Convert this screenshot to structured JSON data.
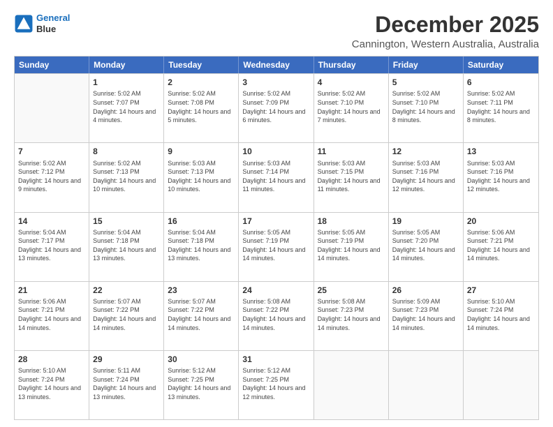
{
  "header": {
    "logo_line1": "General",
    "logo_line2": "Blue",
    "title": "December 2025",
    "subtitle": "Cannington, Western Australia, Australia"
  },
  "calendar": {
    "days_of_week": [
      "Sunday",
      "Monday",
      "Tuesday",
      "Wednesday",
      "Thursday",
      "Friday",
      "Saturday"
    ],
    "weeks": [
      [
        {
          "day": "",
          "empty": true
        },
        {
          "day": "1",
          "sunrise": "5:02 AM",
          "sunset": "7:07 PM",
          "daylight": "14 hours and 4 minutes."
        },
        {
          "day": "2",
          "sunrise": "5:02 AM",
          "sunset": "7:08 PM",
          "daylight": "14 hours and 5 minutes."
        },
        {
          "day": "3",
          "sunrise": "5:02 AM",
          "sunset": "7:09 PM",
          "daylight": "14 hours and 6 minutes."
        },
        {
          "day": "4",
          "sunrise": "5:02 AM",
          "sunset": "7:10 PM",
          "daylight": "14 hours and 7 minutes."
        },
        {
          "day": "5",
          "sunrise": "5:02 AM",
          "sunset": "7:10 PM",
          "daylight": "14 hours and 8 minutes."
        },
        {
          "day": "6",
          "sunrise": "5:02 AM",
          "sunset": "7:11 PM",
          "daylight": "14 hours and 8 minutes."
        }
      ],
      [
        {
          "day": "7",
          "sunrise": "5:02 AM",
          "sunset": "7:12 PM",
          "daylight": "14 hours and 9 minutes."
        },
        {
          "day": "8",
          "sunrise": "5:02 AM",
          "sunset": "7:13 PM",
          "daylight": "14 hours and 10 minutes."
        },
        {
          "day": "9",
          "sunrise": "5:03 AM",
          "sunset": "7:13 PM",
          "daylight": "14 hours and 10 minutes."
        },
        {
          "day": "10",
          "sunrise": "5:03 AM",
          "sunset": "7:14 PM",
          "daylight": "14 hours and 11 minutes."
        },
        {
          "day": "11",
          "sunrise": "5:03 AM",
          "sunset": "7:15 PM",
          "daylight": "14 hours and 11 minutes."
        },
        {
          "day": "12",
          "sunrise": "5:03 AM",
          "sunset": "7:16 PM",
          "daylight": "14 hours and 12 minutes."
        },
        {
          "day": "13",
          "sunrise": "5:03 AM",
          "sunset": "7:16 PM",
          "daylight": "14 hours and 12 minutes."
        }
      ],
      [
        {
          "day": "14",
          "sunrise": "5:04 AM",
          "sunset": "7:17 PM",
          "daylight": "14 hours and 13 minutes."
        },
        {
          "day": "15",
          "sunrise": "5:04 AM",
          "sunset": "7:18 PM",
          "daylight": "14 hours and 13 minutes."
        },
        {
          "day": "16",
          "sunrise": "5:04 AM",
          "sunset": "7:18 PM",
          "daylight": "14 hours and 13 minutes."
        },
        {
          "day": "17",
          "sunrise": "5:05 AM",
          "sunset": "7:19 PM",
          "daylight": "14 hours and 14 minutes."
        },
        {
          "day": "18",
          "sunrise": "5:05 AM",
          "sunset": "7:19 PM",
          "daylight": "14 hours and 14 minutes."
        },
        {
          "day": "19",
          "sunrise": "5:05 AM",
          "sunset": "7:20 PM",
          "daylight": "14 hours and 14 minutes."
        },
        {
          "day": "20",
          "sunrise": "5:06 AM",
          "sunset": "7:21 PM",
          "daylight": "14 hours and 14 minutes."
        }
      ],
      [
        {
          "day": "21",
          "sunrise": "5:06 AM",
          "sunset": "7:21 PM",
          "daylight": "14 hours and 14 minutes."
        },
        {
          "day": "22",
          "sunrise": "5:07 AM",
          "sunset": "7:22 PM",
          "daylight": "14 hours and 14 minutes."
        },
        {
          "day": "23",
          "sunrise": "5:07 AM",
          "sunset": "7:22 PM",
          "daylight": "14 hours and 14 minutes."
        },
        {
          "day": "24",
          "sunrise": "5:08 AM",
          "sunset": "7:22 PM",
          "daylight": "14 hours and 14 minutes."
        },
        {
          "day": "25",
          "sunrise": "5:08 AM",
          "sunset": "7:23 PM",
          "daylight": "14 hours and 14 minutes."
        },
        {
          "day": "26",
          "sunrise": "5:09 AM",
          "sunset": "7:23 PM",
          "daylight": "14 hours and 14 minutes."
        },
        {
          "day": "27",
          "sunrise": "5:10 AM",
          "sunset": "7:24 PM",
          "daylight": "14 hours and 14 minutes."
        }
      ],
      [
        {
          "day": "28",
          "sunrise": "5:10 AM",
          "sunset": "7:24 PM",
          "daylight": "14 hours and 13 minutes."
        },
        {
          "day": "29",
          "sunrise": "5:11 AM",
          "sunset": "7:24 PM",
          "daylight": "14 hours and 13 minutes."
        },
        {
          "day": "30",
          "sunrise": "5:12 AM",
          "sunset": "7:25 PM",
          "daylight": "14 hours and 13 minutes."
        },
        {
          "day": "31",
          "sunrise": "5:12 AM",
          "sunset": "7:25 PM",
          "daylight": "14 hours and 12 minutes."
        },
        {
          "day": "",
          "empty": true
        },
        {
          "day": "",
          "empty": true
        },
        {
          "day": "",
          "empty": true
        }
      ]
    ]
  }
}
